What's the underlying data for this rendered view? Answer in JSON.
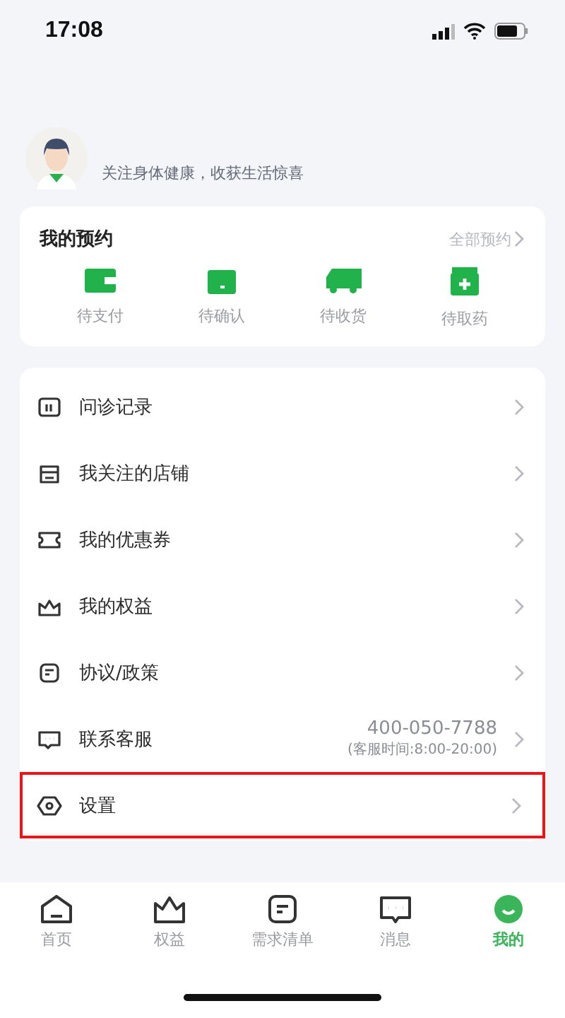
{
  "status_bar": {
    "time": "17:08"
  },
  "profile": {
    "slogan": "关注身体健康，收获生活惊喜"
  },
  "appointments": {
    "title": "我的预约",
    "link": "全部预约",
    "items": [
      {
        "label": "待支付"
      },
      {
        "label": "待确认"
      },
      {
        "label": "待收货"
      },
      {
        "label": "待取药"
      }
    ]
  },
  "menu": [
    {
      "label": "问诊记录",
      "highlighted": false
    },
    {
      "label": "我关注的店铺",
      "highlighted": false
    },
    {
      "label": "我的优惠券",
      "highlighted": false
    },
    {
      "label": "我的权益",
      "highlighted": false
    },
    {
      "label": "协议/政策",
      "highlighted": false
    },
    {
      "label": "联系客服",
      "phone": "400-050-7788",
      "hours": "(客服时间:8:00-20:00)",
      "highlighted": false
    },
    {
      "label": "设置",
      "highlighted": true
    }
  ],
  "tab_bar": [
    {
      "label": "首页",
      "selected": false
    },
    {
      "label": "权益",
      "selected": false
    },
    {
      "label": "需求清单",
      "selected": false
    },
    {
      "label": "消息",
      "selected": false
    },
    {
      "label": "我的",
      "selected": true
    }
  ]
}
